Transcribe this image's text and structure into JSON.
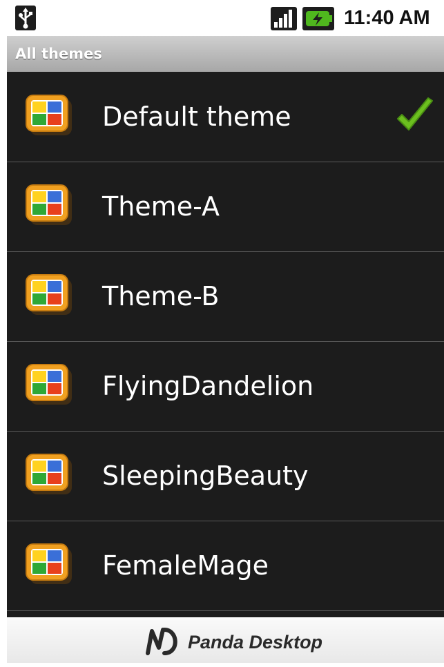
{
  "status_bar": {
    "time": "11:40 AM",
    "icons": [
      "usb-icon",
      "signal-icon",
      "battery-charging-icon"
    ]
  },
  "title_bar": {
    "title": "All themes"
  },
  "themes": [
    {
      "label": "Default theme",
      "selected": true
    },
    {
      "label": "Theme-A",
      "selected": false
    },
    {
      "label": "Theme-B",
      "selected": false
    },
    {
      "label": "FlyingDandelion",
      "selected": false
    },
    {
      "label": "SleepingBeauty",
      "selected": false
    },
    {
      "label": "FemaleMage",
      "selected": false
    }
  ],
  "footer": {
    "brand": "Panda Desktop"
  },
  "colors": {
    "list_bg": "#1c1c1c",
    "check_green": "#6cbf1f",
    "icon_frame": "#f0a020"
  }
}
